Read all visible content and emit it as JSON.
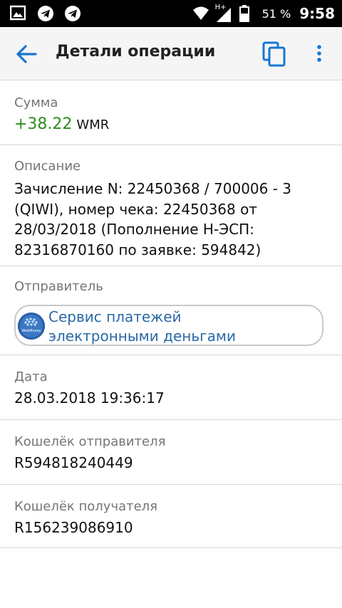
{
  "status_bar": {
    "battery_percent": "51 %",
    "time": "9:58",
    "network_type": "H+",
    "icons": [
      "gallery-icon",
      "telegram-icon",
      "telegram-icon",
      "wifi-icon",
      "signal-icon",
      "battery-icon"
    ]
  },
  "app_bar": {
    "title": "Детали операции",
    "accent_color": "#1976d2"
  },
  "amount": {
    "label": "Сумма",
    "value": "+38.22",
    "currency": "WMR",
    "value_color": "#2e8b20"
  },
  "description": {
    "label": "Описание",
    "text": "Зачисление N: 22450368 / 700006 - 3 (QIWI), номер чека: 22450368 от 28/03/2018 (Пополнение Н-ЭСП: 82316870160 по заявке: 594842)"
  },
  "sender": {
    "label": "Отправитель",
    "name": "Сервис платежей электронными деньгами",
    "logo_text": "WebMoney"
  },
  "date": {
    "label": "Дата",
    "value": "28.03.2018 19:36:17"
  },
  "sender_wallet": {
    "label": "Кошелёк отправителя",
    "value": "R594818240449"
  },
  "recipient_wallet": {
    "label": "Кошелёк получателя",
    "value": "R156239086910"
  }
}
